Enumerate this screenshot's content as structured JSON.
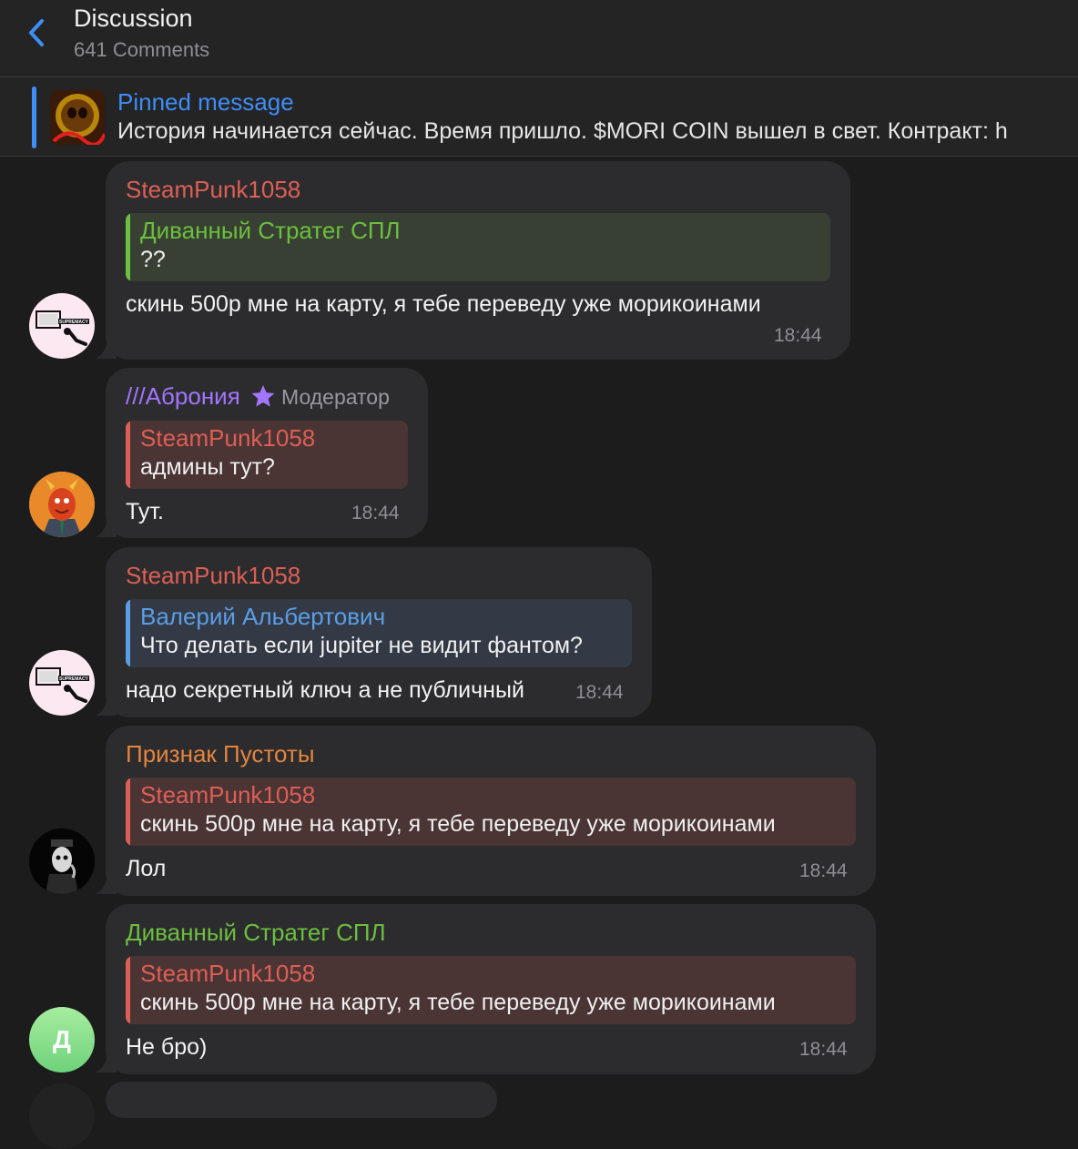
{
  "header": {
    "title": "Discussion",
    "subtitle": "641 Comments"
  },
  "pinned": {
    "label": "Pinned message",
    "text": "История начинается сейчас. Время пришло. $MORI COIN вышел в свет.  Контракт: h"
  },
  "messages": [
    {
      "author": "SteamPunk1058",
      "reply_author": "Диванный Стратег СПЛ",
      "reply_text": "??",
      "text": "скинь 500р мне на карту, я тебе переведу уже морикоинами",
      "time": "18:44"
    },
    {
      "author": "///Аброния",
      "badge": "Модератор",
      "reply_author": "SteamPunk1058",
      "reply_text": "админы тут?",
      "text": "Тут.",
      "time": "18:44"
    },
    {
      "author": "SteamPunk1058",
      "reply_author": "Валерий Альбертович",
      "reply_text": "Что делать если jupiter не видит фантом?",
      "text": "надо секретный ключ а не публичный",
      "time": "18:44"
    },
    {
      "author": "Признак Пустоты",
      "reply_author": "SteamPunk1058",
      "reply_text": "скинь 500р мне на карту, я тебе переведу уже морикоинами",
      "text": "Лол",
      "time": "18:44"
    },
    {
      "author": "Диванный Стратег СПЛ",
      "avatar_letter": "Д",
      "reply_author": "SteamPunk1058",
      "reply_text": "скинь 500р мне на карту, я тебе переведу уже морикоинами",
      "text": "Не бро)",
      "time": "18:44"
    }
  ],
  "avatar_texts": {
    "supremacy": "SUPREMACY"
  },
  "colors": {
    "accent": "#3f8ef6",
    "red_name": "#dd5f55",
    "green_name": "#6cbf3f",
    "purple_name": "#a275ff",
    "orange_name": "#e4843f",
    "blue_name": "#5b9ee6"
  },
  "icons": {
    "back": "chevron-left-icon",
    "moderator": "star-icon"
  }
}
